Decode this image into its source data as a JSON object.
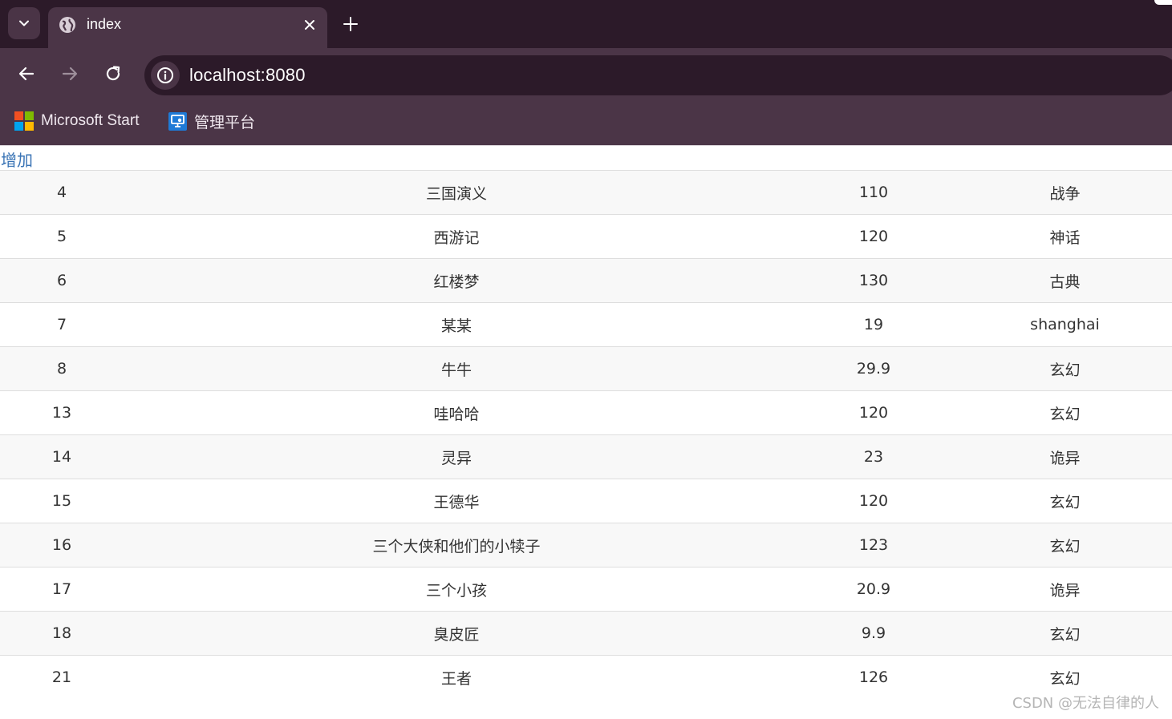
{
  "browser": {
    "tab_title": "index",
    "url": "localhost:8080",
    "bookmarks": [
      {
        "label": "Microsoft Start",
        "icon": "microsoft-logo-icon"
      },
      {
        "label": "管理平台",
        "icon": "remote-desktop-icon"
      }
    ]
  },
  "page": {
    "add_link_label": "增加",
    "rows": [
      {
        "id": "4",
        "name": "三国演义",
        "price": "110",
        "category": "战争"
      },
      {
        "id": "5",
        "name": "西游记",
        "price": "120",
        "category": "神话"
      },
      {
        "id": "6",
        "name": "红楼梦",
        "price": "130",
        "category": "古典"
      },
      {
        "id": "7",
        "name": "某某",
        "price": "19",
        "category": "shanghai"
      },
      {
        "id": "8",
        "name": "牛牛",
        "price": "29.9",
        "category": "玄幻"
      },
      {
        "id": "13",
        "name": "哇哈哈",
        "price": "120",
        "category": "玄幻"
      },
      {
        "id": "14",
        "name": "灵异",
        "price": "23",
        "category": "诡异"
      },
      {
        "id": "15",
        "name": "王德华",
        "price": "120",
        "category": "玄幻"
      },
      {
        "id": "16",
        "name": "三个大侠和他们的小犊子",
        "price": "123",
        "category": "玄幻"
      },
      {
        "id": "17",
        "name": "三个小孩",
        "price": "20.9",
        "category": "诡异"
      },
      {
        "id": "18",
        "name": "臭皮匠",
        "price": "9.9",
        "category": "玄幻"
      },
      {
        "id": "21",
        "name": "王者",
        "price": "126",
        "category": "玄幻"
      }
    ]
  },
  "watermark": "CSDN @无法自律的人",
  "colors": {
    "tabstrip": "#2c1a29",
    "toolbar": "#4b3547",
    "link": "#3a74b5",
    "row_striped": "#f8f8f8"
  }
}
